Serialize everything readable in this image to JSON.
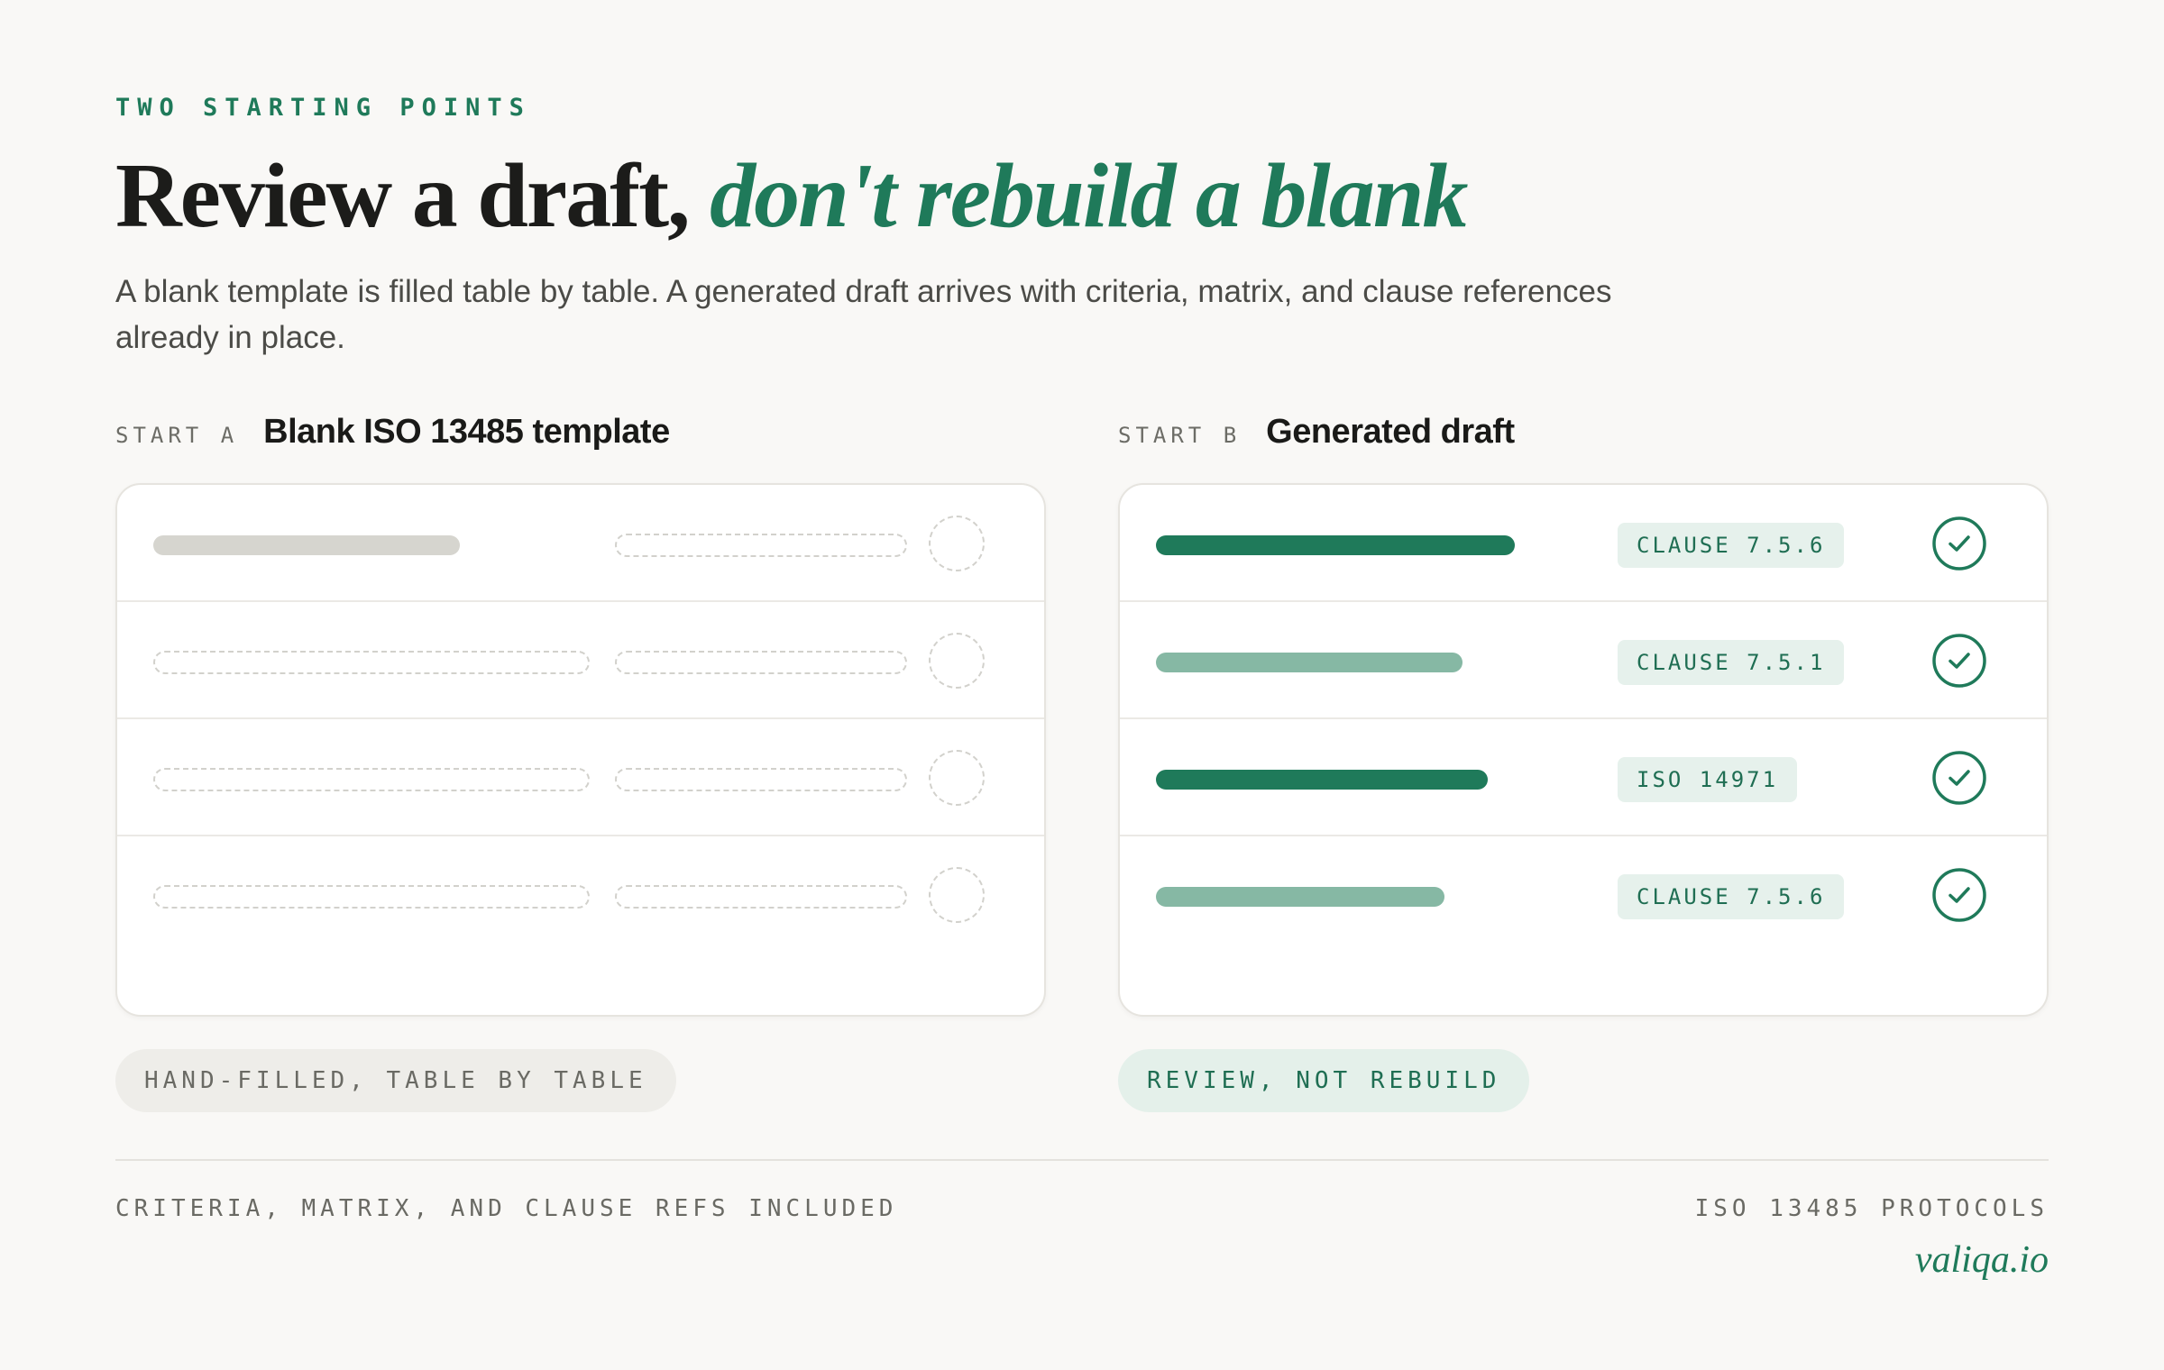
{
  "header": {
    "eyebrow": "TWO STARTING POINTS",
    "headline_main": "Review a draft, ",
    "headline_accent": "don't rebuild a blank",
    "lead": "A blank template is filled table by table. A generated draft arrives with criteria, matrix, and clause references already in place."
  },
  "panel_a": {
    "tag": "START A",
    "title": "Blank ISO 13485 template",
    "rows_filled": 0,
    "rows_total": 4,
    "caption": "HAND-FILLED, TABLE BY TABLE"
  },
  "panel_b": {
    "tag": "START B",
    "title": "Generated draft",
    "rows": [
      {
        "clause": "CLAUSE 7.5.6",
        "emphasis": "strong",
        "checked": true
      },
      {
        "clause": "CLAUSE 7.5.1",
        "emphasis": "light",
        "checked": true
      },
      {
        "clause": "ISO 14971",
        "emphasis": "strong",
        "checked": true
      },
      {
        "clause": "CLAUSE 7.5.6",
        "emphasis": "light",
        "checked": true
      }
    ],
    "caption": "REVIEW, NOT REBUILD"
  },
  "footer": {
    "left": "CRITERIA, MATRIX, AND CLAUSE REFS INCLUDED",
    "right": "ISO 13485 PROTOCOLS",
    "brand": "valiqa.io"
  },
  "colors": {
    "accent": "#1f7a5a",
    "accent_light": "#86b8a4",
    "placeholder": "#d6d5cf",
    "background": "#f9f8f6"
  },
  "icons": {
    "check": "check-circle-icon",
    "empty": "empty-circle-placeholder"
  }
}
